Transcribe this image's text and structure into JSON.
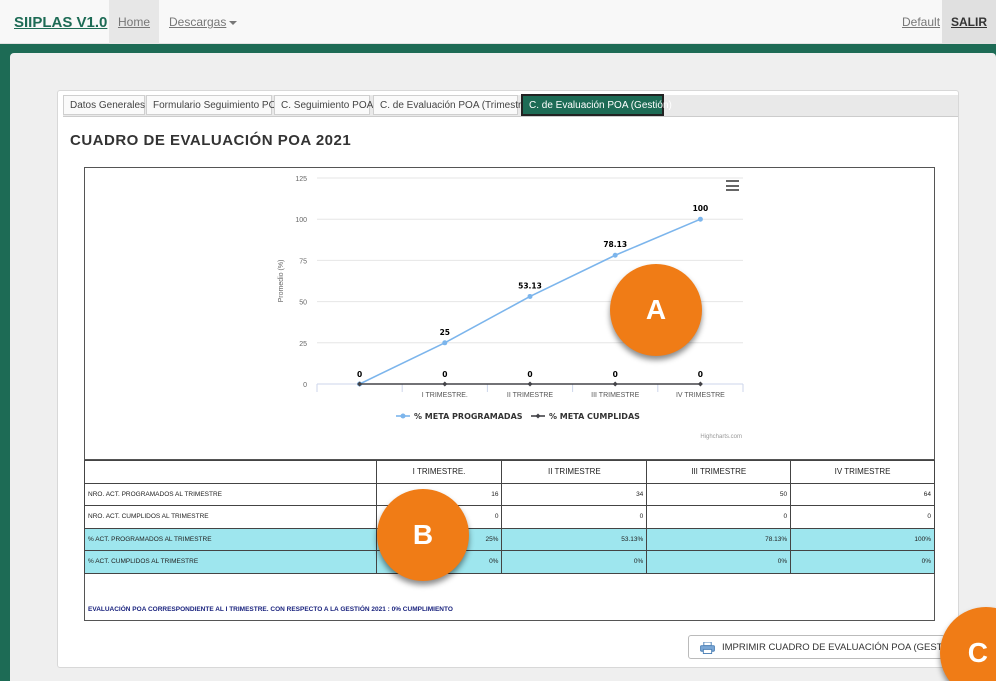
{
  "navbar": {
    "brand": "SIIPLAS V1.0",
    "home": "Home",
    "descargas": "Descargas",
    "default": "Default",
    "salir": "SALIR"
  },
  "tabs": [
    {
      "label": "Datos Generales"
    },
    {
      "label": "Formulario Seguimiento POA"
    },
    {
      "label": "C. Seguimiento POA"
    },
    {
      "label": "C. de Evaluación POA (Trimestre)"
    },
    {
      "label": "C. de Evaluación POA (Gestión)"
    }
  ],
  "page_title": "CUADRO DE EVALUACIÓN POA 2021",
  "chart_data": {
    "type": "line",
    "categories": [
      "",
      "I TRIMESTRE.",
      "II TRIMESTRE",
      "III TRIMESTRE",
      "IV TRIMESTRE"
    ],
    "ylabel": "Promedio (%)",
    "ylim": [
      0,
      125
    ],
    "yticks": [
      0,
      25,
      50,
      75,
      100,
      125
    ],
    "grid": true,
    "legend_position": "bottom",
    "credits": "Highcharts.com",
    "series": [
      {
        "name": "% META PROGRAMADAS",
        "values": [
          0,
          25,
          53.13,
          78.13,
          100
        ],
        "labels": [
          "0",
          "25",
          "53.13",
          "78.13",
          "100"
        ],
        "color": "#7cb5ec"
      },
      {
        "name": "% META CUMPLIDAS",
        "values": [
          0,
          0,
          0,
          0,
          0
        ],
        "labels": [
          "0",
          "0",
          "0",
          "0",
          "0"
        ],
        "color": "#434348"
      }
    ]
  },
  "table": {
    "headers": [
      "I TRIMESTRE.",
      "II TRIMESTRE",
      "III TRIMESTRE",
      "IV TRIMESTRE"
    ],
    "rows": [
      {
        "label": "NRO. ACT. PROGRAMADOS AL TRIMESTRE",
        "values": [
          "16",
          "34",
          "50",
          "64"
        ],
        "highlight": false
      },
      {
        "label": "NRO. ACT. CUMPLIDOS AL TRIMESTRE",
        "values": [
          "0",
          "0",
          "0",
          "0"
        ],
        "highlight": false
      },
      {
        "label": "% ACT. PROGRAMADOS AL TRIMESTRE",
        "values": [
          "25%",
          "53.13%",
          "78.13%",
          "100%"
        ],
        "highlight": true
      },
      {
        "label": "% ACT. CUMPLIDOS AL TRIMESTRE",
        "values": [
          "0%",
          "0%",
          "0%",
          "0%"
        ],
        "highlight": true
      }
    ]
  },
  "evaluation_note": "EVALUACIÓN POA CORRESPONDIENTE AL I TRIMESTRE. CON RESPECTO A LA GESTIÓN 2021 : 0% CUMPLIMIENTO",
  "print_button": "IMPRIMIR CUADRO DE EVALUACIÓN POA (GESTIÓN)",
  "badges": {
    "a": "A",
    "b": "B",
    "c": "C"
  },
  "colors": {
    "brand": "#1d6b55",
    "badge": "#f07c16",
    "highlight_row": "#9ee6ee"
  }
}
